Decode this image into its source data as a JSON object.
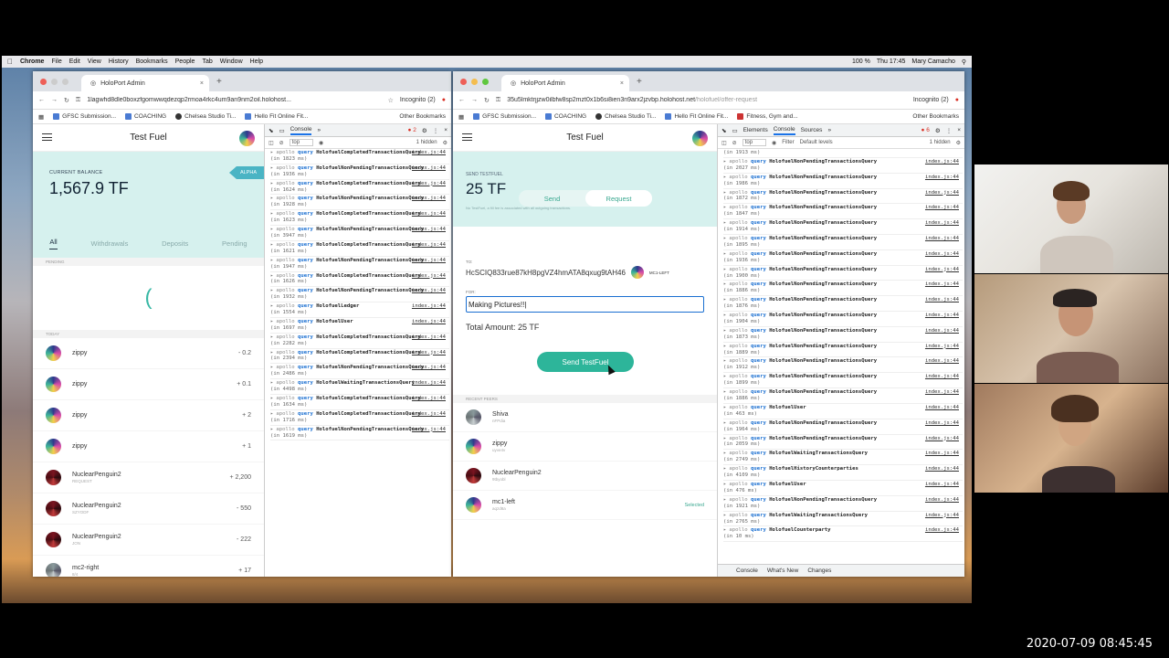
{
  "timestamp": "2020-07-09 08:45:45",
  "menubar": {
    "items": [
      "Chrome",
      "File",
      "Edit",
      "View",
      "History",
      "Bookmarks",
      "People",
      "Tab",
      "Window",
      "Help"
    ],
    "right": {
      "battery": "100 %",
      "time": "Thu 17:45",
      "user": "Mary Camacho"
    }
  },
  "window1": {
    "tab_title": "HoloPort Admin",
    "url": "1lagwhd8dle0boxzfgomwwqdezqp2rmoa4rkc4um9an9nm2oil.holohost...",
    "incognito": "Incognito (2)",
    "bookmarks": [
      "GFSC Submission...",
      "COACHING",
      "Chelsea Studio Ti...",
      "Hello Fit Online Fit..."
    ],
    "other_bookmarks": "Other Bookmarks",
    "app": {
      "title": "Test Fuel",
      "balance_label": "CURRENT BALANCE",
      "balance": "1,567.9 TF",
      "alpha": "ALPHA",
      "tabs": [
        "All",
        "Withdrawals",
        "Deposits",
        "Pending"
      ],
      "pending_label": "PENDING",
      "spinner": "(",
      "today_label": "TODAY",
      "transactions": [
        {
          "name": "zippy",
          "sub": "",
          "amount": "- 0.2"
        },
        {
          "name": "zippy",
          "sub": "",
          "amount": "+ 0.1"
        },
        {
          "name": "zippy",
          "sub": "",
          "amount": "+ 2"
        },
        {
          "name": "zippy",
          "sub": "",
          "amount": "+ 1"
        },
        {
          "name": "NuclearPenguin2",
          "sub": "REQUEST",
          "amount": "+ 2,200"
        },
        {
          "name": "NuclearPenguin2",
          "sub": "SZYODF",
          "amount": "- 550"
        },
        {
          "name": "NuclearPenguin2",
          "sub": "JON",
          "amount": "- 222"
        },
        {
          "name": "mc2-right",
          "sub": "8/4",
          "amount": "+ 17"
        }
      ]
    },
    "devtools": {
      "tab": "Console",
      "errors": "2",
      "context": "top",
      "hidden": "1 hidden",
      "log": [
        {
          "name": "HolofuelCompletedTransactionsQuery",
          "ms": "(in 1823 ms)"
        },
        {
          "name": "HolofuelNonPendingTransactionsQuery",
          "ms": "(in 1936 ms)"
        },
        {
          "name": "HolofuelCompletedTransactionsQuery",
          "ms": "(in 1624 ms)"
        },
        {
          "name": "HolofuelNonPendingTransactionsQuery",
          "ms": "(in 1928 ms)"
        },
        {
          "name": "HolofuelCompletedTransactionsQuery",
          "ms": "(in 1623 ms)"
        },
        {
          "name": "HolofuelNonPendingTransactionsQuery",
          "ms": "(in 3947 ms)"
        },
        {
          "name": "HolofuelCompletedTransactionsQuery",
          "ms": "(in 1621 ms)"
        },
        {
          "name": "HolofuelNonPendingTransactionsQuery",
          "ms": "(in 1947 ms)"
        },
        {
          "name": "HolofuelCompletedTransactionsQuery",
          "ms": "(in 1626 ms)"
        },
        {
          "name": "HolofuelNonPendingTransactionsQuery",
          "ms": "(in 1932 ms)"
        },
        {
          "name": "HolofuelLedger",
          "ms": "(in 1554 ms)"
        },
        {
          "name": "HolofuelUser",
          "ms": "(in 1697 ms)"
        },
        {
          "name": "HolofuelCompletedTransactionsQuery",
          "ms": "(in 2282 ms)"
        },
        {
          "name": "HolofuelCompletedTransactionsQuery",
          "ms": "(in 2394 ms)"
        },
        {
          "name": "HolofuelNonPendingTransactionsQuery",
          "ms": "(in 2486 ms)"
        },
        {
          "name": "HolofuelWaitingTransactionsQuery",
          "ms": "(in 4498 ms)"
        },
        {
          "name": "HolofuelCompletedTransactionsQuery",
          "ms": "(in 1634 ms)"
        },
        {
          "name": "HolofuelCompletedTransactionsQuery",
          "ms": "(in 1716 ms)"
        },
        {
          "name": "HolofuelNonPendingTransactionsQuery",
          "ms": "(in 1619 ms)"
        }
      ],
      "src": "index.js:44",
      "prefix": "apollo",
      "qword": "query"
    }
  },
  "window2": {
    "tab_title": "HoloPort Admin",
    "url": "35u5lmktrjjzw0ilbfw8sp2mzt0x1b6si8ien3n9arx2jzvbp.holohost.net",
    "url_path": "/holofuel/offer-request",
    "incognito": "Incognito (2)",
    "bookmarks": [
      "GFSC Submission...",
      "COACHING",
      "Chelsea Studio Ti...",
      "Hello Fit Online Fit...",
      "Fitness, Gym and..."
    ],
    "other_bookmarks": "Other Bookmarks",
    "app": {
      "title": "Test Fuel",
      "send_label": "SEND TESTFUEL",
      "amount": "25 TF",
      "note": "No TestFuel, a fill fee is associated with all outgoing transactions.",
      "seg": [
        "Send",
        "Request"
      ],
      "to_label": "TO:",
      "to_value": "HcSCIQ833rue87kH8pgVZ4hmATA8qxug9tAH46",
      "to_tag": "MC1-LEFT",
      "for_label": "FOR:",
      "for_value": "Making Pictures!!|",
      "total": "Total Amount: 25 TF",
      "send_button": "Send TestFuel",
      "recent_label": "RECENT PEERS",
      "peers": [
        {
          "name": "Shiva",
          "sub": "nFPdia",
          "selected": ""
        },
        {
          "name": "zippy",
          "sub": "uyve4v",
          "selected": ""
        },
        {
          "name": "NuclearPenguin2",
          "sub": "9tbyobl",
          "selected": ""
        },
        {
          "name": "mc1-left",
          "sub": "aqzd8a",
          "selected": "Selected"
        }
      ]
    },
    "devtools": {
      "tabs": [
        "Elements",
        "Console",
        "Sources"
      ],
      "errors": "6",
      "context": "top",
      "filter": "Filter",
      "levels": "Default levels",
      "hidden": "1 hidden",
      "bottom_tabs": [
        "Console",
        "What's New",
        "Changes"
      ],
      "log": [
        {
          "name": "",
          "ms": "(in 1913 ms)"
        },
        {
          "name": "HolofuelNonPendingTransactionsQuery",
          "ms": "(in 2027 ms)"
        },
        {
          "name": "HolofuelNonPendingTransactionsQuery",
          "ms": "(in 1986 ms)"
        },
        {
          "name": "HolofuelNonPendingTransactionsQuery",
          "ms": "(in 1872 ms)"
        },
        {
          "name": "HolofuelNonPendingTransactionsQuery",
          "ms": "(in 1847 ms)"
        },
        {
          "name": "HolofuelNonPendingTransactionsQuery",
          "ms": "(in 1914 ms)"
        },
        {
          "name": "HolofuelNonPendingTransactionsQuery",
          "ms": "(in 1895 ms)"
        },
        {
          "name": "HolofuelNonPendingTransactionsQuery",
          "ms": "(in 1936 ms)"
        },
        {
          "name": "HolofuelNonPendingTransactionsQuery",
          "ms": "(in 1900 ms)"
        },
        {
          "name": "HolofuelNonPendingTransactionsQuery",
          "ms": "(in 1886 ms)"
        },
        {
          "name": "HolofuelNonPendingTransactionsQuery",
          "ms": "(in 1876 ms)"
        },
        {
          "name": "HolofuelNonPendingTransactionsQuery",
          "ms": "(in 1904 ms)"
        },
        {
          "name": "HolofuelNonPendingTransactionsQuery",
          "ms": "(in 1873 ms)"
        },
        {
          "name": "HolofuelNonPendingTransactionsQuery",
          "ms": "(in 1889 ms)"
        },
        {
          "name": "HolofuelNonPendingTransactionsQuery",
          "ms": "(in 1912 ms)"
        },
        {
          "name": "HolofuelNonPendingTransactionsQuery",
          "ms": "(in 1899 ms)"
        },
        {
          "name": "HolofuelNonPendingTransactionsQuery",
          "ms": "(in 1886 ms)"
        },
        {
          "name": "HolofuelUser",
          "ms": "(in 463 ms)"
        },
        {
          "name": "HolofuelNonPendingTransactionsQuery",
          "ms": "(in 1964 ms)"
        },
        {
          "name": "HolofuelNonPendingTransactionsQuery",
          "ms": "(in 2059 ms)"
        },
        {
          "name": "HolofuelWaitingTransactionsQuery",
          "ms": "(in 2749 ms)"
        },
        {
          "name": "HolofuelHistoryCounterparties",
          "ms": "(in 4109 ms)"
        },
        {
          "name": "HolofuelUser",
          "ms": "(in 476 ms)"
        },
        {
          "name": "HolofuelNonPendingTransactionsQuery",
          "ms": "(in 1921 ms)"
        },
        {
          "name": "HolofuelWaitingTransactionsQuery",
          "ms": "(in 2765 ms)"
        },
        {
          "name": "HolofuelCounterparty",
          "ms": "(in 10 ms)"
        }
      ]
    }
  }
}
